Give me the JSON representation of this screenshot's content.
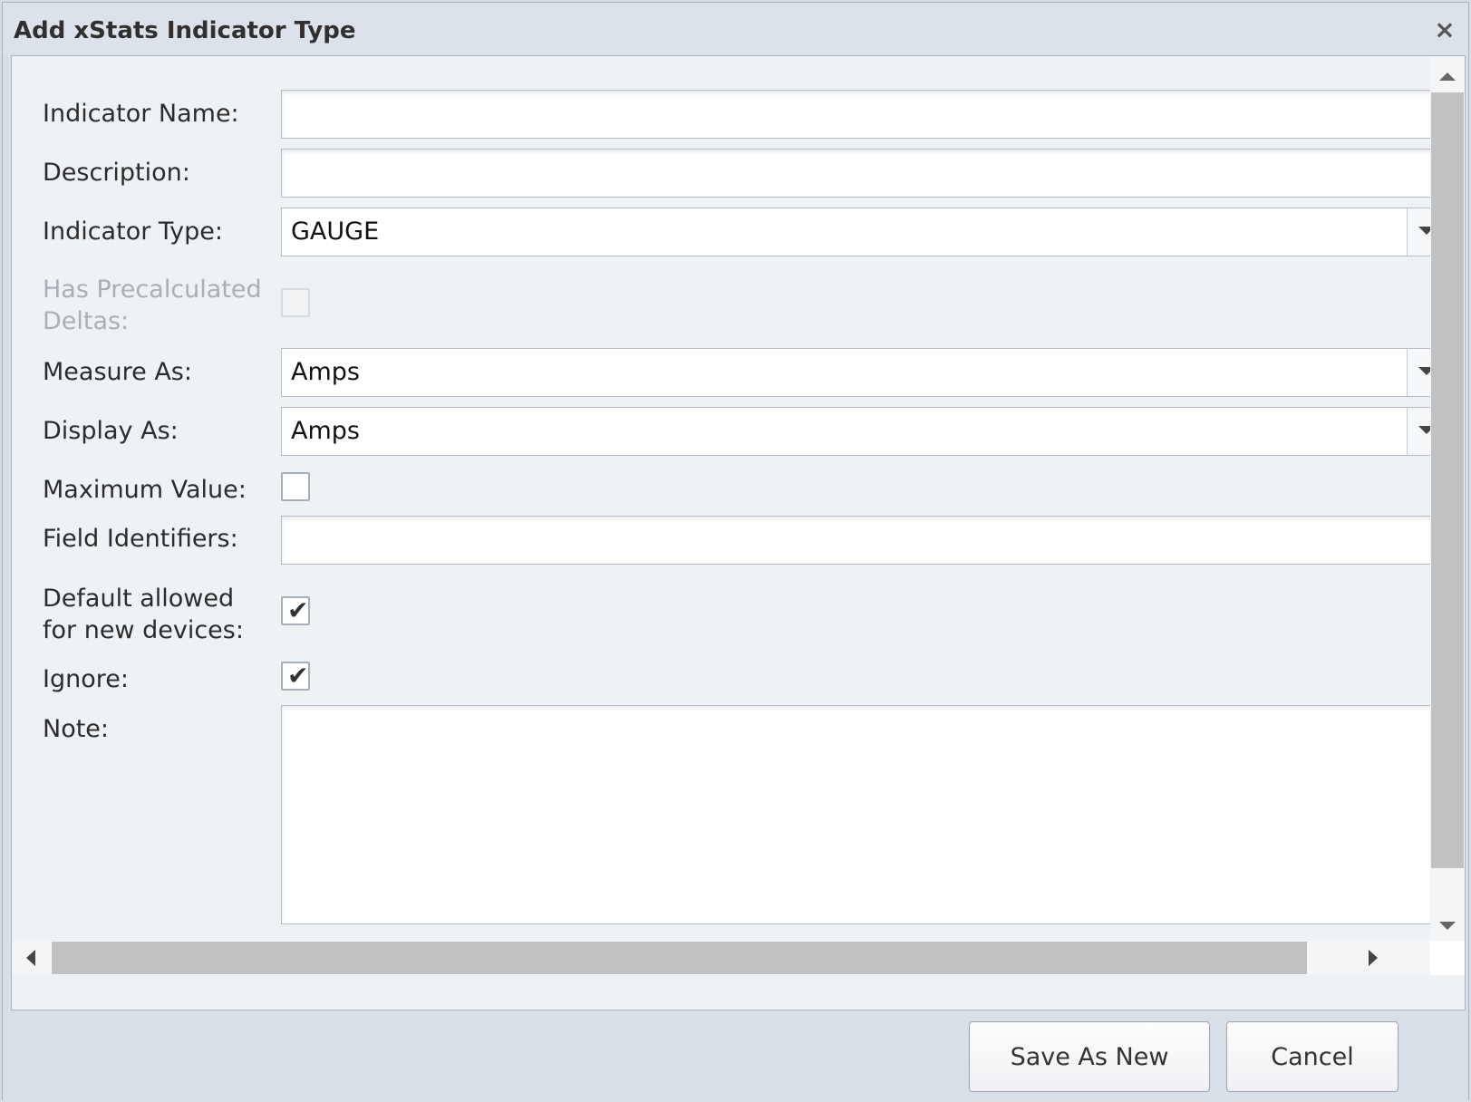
{
  "dialog": {
    "title": "Add xStats Indicator Type",
    "close_symbol": "×"
  },
  "form": {
    "indicator_name": {
      "label": "Indicator Name:",
      "value": ""
    },
    "description": {
      "label": "Description:",
      "value": ""
    },
    "indicator_type": {
      "label": "Indicator Type:",
      "value": "GAUGE"
    },
    "has_precalculated_deltas": {
      "label_line1": "Has Precalculated",
      "label_line2": "Deltas:",
      "checked": false,
      "disabled": true
    },
    "measure_as": {
      "label": "Measure As:",
      "value": "Amps"
    },
    "display_as": {
      "label": "Display As:",
      "value": "Amps"
    },
    "maximum_value": {
      "label": "Maximum Value:",
      "checked": false
    },
    "field_identifiers": {
      "label": "Field Identifiers:",
      "value": ""
    },
    "default_allowed": {
      "label_line1": "Default allowed",
      "label_line2": "for new devices:",
      "checked": true,
      "check_symbol": "✔"
    },
    "ignore": {
      "label": "Ignore:",
      "checked": true,
      "check_symbol": "✔"
    },
    "note": {
      "label": "Note:",
      "value": ""
    }
  },
  "buttons": {
    "save_as_new": "Save As New",
    "cancel": "Cancel"
  },
  "icons": {
    "close": "close-icon",
    "dropdown": "chevron-down-icon",
    "check": "check-icon"
  }
}
